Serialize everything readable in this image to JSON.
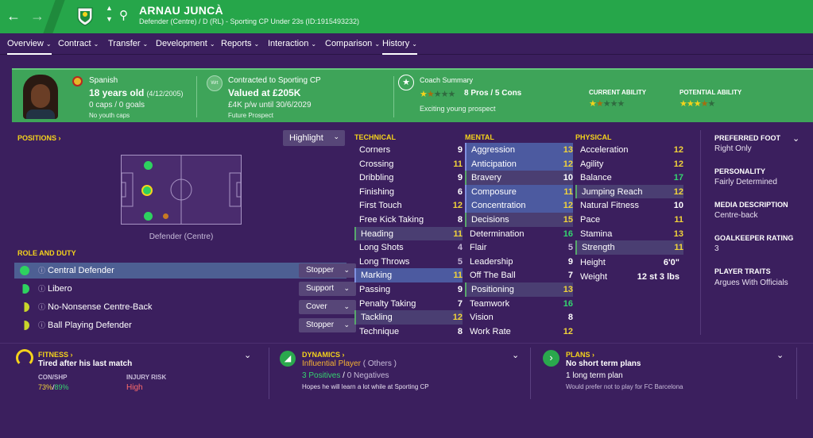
{
  "player": {
    "name": "ARNAU JUNCÀ",
    "subtitle": "Defender (Centre) / D (RL) - Sporting CP Under 23s (ID:1915493232)"
  },
  "nav": [
    {
      "label": "Overview"
    },
    {
      "label": "Contract"
    },
    {
      "label": "Transfer"
    },
    {
      "label": "Development"
    },
    {
      "label": "Reports"
    },
    {
      "label": "Interaction"
    },
    {
      "label": "Comparison"
    },
    {
      "label": "History"
    }
  ],
  "band": {
    "nationality": "Spanish",
    "age": "18 years old",
    "dob": "(4/12/2005)",
    "caps": "0 caps / 0 goals",
    "youth_caps": "No youth caps",
    "wrt_badge": "Wrt",
    "contract_label": "Contracted to Sporting CP",
    "value": "Valued at £205K",
    "wage": "£4K p/w until 30/6/2029",
    "prospect": "Future Prospect",
    "coach_label": "Coach Summary",
    "pros_cons": "8 Pros / 5 Cons",
    "coach_note": "Exciting young prospect",
    "ca_label": "CURRENT ABILITY",
    "pa_label": "POTENTIAL ABILITY",
    "coach_stars": 1.5,
    "ca_stars": 1.5,
    "pa_stars": 3.5
  },
  "positions": {
    "heading": "POSITIONS",
    "highlight_btn": "Highlight",
    "pitch_caption": "Defender (Centre)"
  },
  "roles": {
    "heading": "ROLE AND DUTY",
    "items": [
      {
        "name": "Central Defender",
        "duty": "Stopper"
      },
      {
        "name": "Libero",
        "duty": "Support"
      },
      {
        "name": "No-Nonsense Centre-Back",
        "duty": "Cover"
      },
      {
        "name": "Ball Playing Defender",
        "duty": "Stopper"
      }
    ]
  },
  "technical": {
    "heading": "TECHNICAL",
    "attrs": [
      {
        "name": "Corners",
        "value": "9"
      },
      {
        "name": "Crossing",
        "value": "11"
      },
      {
        "name": "Dribbling",
        "value": "9"
      },
      {
        "name": "Finishing",
        "value": "6"
      },
      {
        "name": "First Touch",
        "value": "12"
      },
      {
        "name": "Free Kick Taking",
        "value": "8"
      },
      {
        "name": "Heading",
        "value": "11"
      },
      {
        "name": "Long Shots",
        "value": "4"
      },
      {
        "name": "Long Throws",
        "value": "5"
      },
      {
        "name": "Marking",
        "value": "11"
      },
      {
        "name": "Passing",
        "value": "9"
      },
      {
        "name": "Penalty Taking",
        "value": "7"
      },
      {
        "name": "Tackling",
        "value": "12"
      },
      {
        "name": "Technique",
        "value": "8"
      }
    ]
  },
  "mental": {
    "heading": "MENTAL",
    "attrs": [
      {
        "name": "Aggression",
        "value": "13"
      },
      {
        "name": "Anticipation",
        "value": "12"
      },
      {
        "name": "Bravery",
        "value": "10"
      },
      {
        "name": "Composure",
        "value": "11"
      },
      {
        "name": "Concentration",
        "value": "12"
      },
      {
        "name": "Decisions",
        "value": "15"
      },
      {
        "name": "Determination",
        "value": "16"
      },
      {
        "name": "Flair",
        "value": "5"
      },
      {
        "name": "Leadership",
        "value": "9"
      },
      {
        "name": "Off The Ball",
        "value": "7"
      },
      {
        "name": "Positioning",
        "value": "13"
      },
      {
        "name": "Teamwork",
        "value": "16"
      },
      {
        "name": "Vision",
        "value": "8"
      },
      {
        "name": "Work Rate",
        "value": "12"
      }
    ]
  },
  "physical": {
    "heading": "PHYSICAL",
    "attrs": [
      {
        "name": "Acceleration",
        "value": "12"
      },
      {
        "name": "Agility",
        "value": "12"
      },
      {
        "name": "Balance",
        "value": "17"
      },
      {
        "name": "Jumping Reach",
        "value": "12"
      },
      {
        "name": "Natural Fitness",
        "value": "10"
      },
      {
        "name": "Pace",
        "value": "11"
      },
      {
        "name": "Stamina",
        "value": "13"
      },
      {
        "name": "Strength",
        "value": "11"
      }
    ],
    "height_label": "Height",
    "height": "6'0\"",
    "weight_label": "Weight",
    "weight": "12 st 3 lbs"
  },
  "side": {
    "foot_label": "PREFERRED FOOT",
    "foot": "Right Only",
    "personality_label": "PERSONALITY",
    "personality": "Fairly Determined",
    "media_label": "MEDIA DESCRIPTION",
    "media": "Centre-back",
    "gk_label": "GOALKEEPER RATING",
    "gk": "3",
    "traits_label": "PLAYER TRAITS",
    "traits": "Argues With Officials"
  },
  "fitness": {
    "heading": "FITNESS",
    "status": "Tired after his last match",
    "conshp_label": "CON/SHP",
    "con": "73%",
    "slash": "/",
    "shp": "89%",
    "injury_label": "INJURY RISK",
    "injury": "High"
  },
  "dynamics": {
    "heading": "DYNAMICS",
    "status": "Influential Player",
    "status_detail": "( Others )",
    "positives": "3 Positives",
    "sep": "/",
    "negatives": "0 Negatives",
    "note": "Hopes he will learn a lot while at Sporting CP"
  },
  "plans": {
    "heading": "PLANS",
    "status": "No short term plans",
    "long": "1 long term plan",
    "note": "Would prefer not to play for FC Barcelona"
  },
  "colors": {
    "header_green": "#26a64a",
    "band_green": "#3ea459",
    "bg_purple": "#3b1f5e",
    "accent_yellow": "#f5d31b",
    "value_green": "#35d470",
    "value_yellow": "#f1d33a",
    "risk_red": "#ff6b6b"
  }
}
